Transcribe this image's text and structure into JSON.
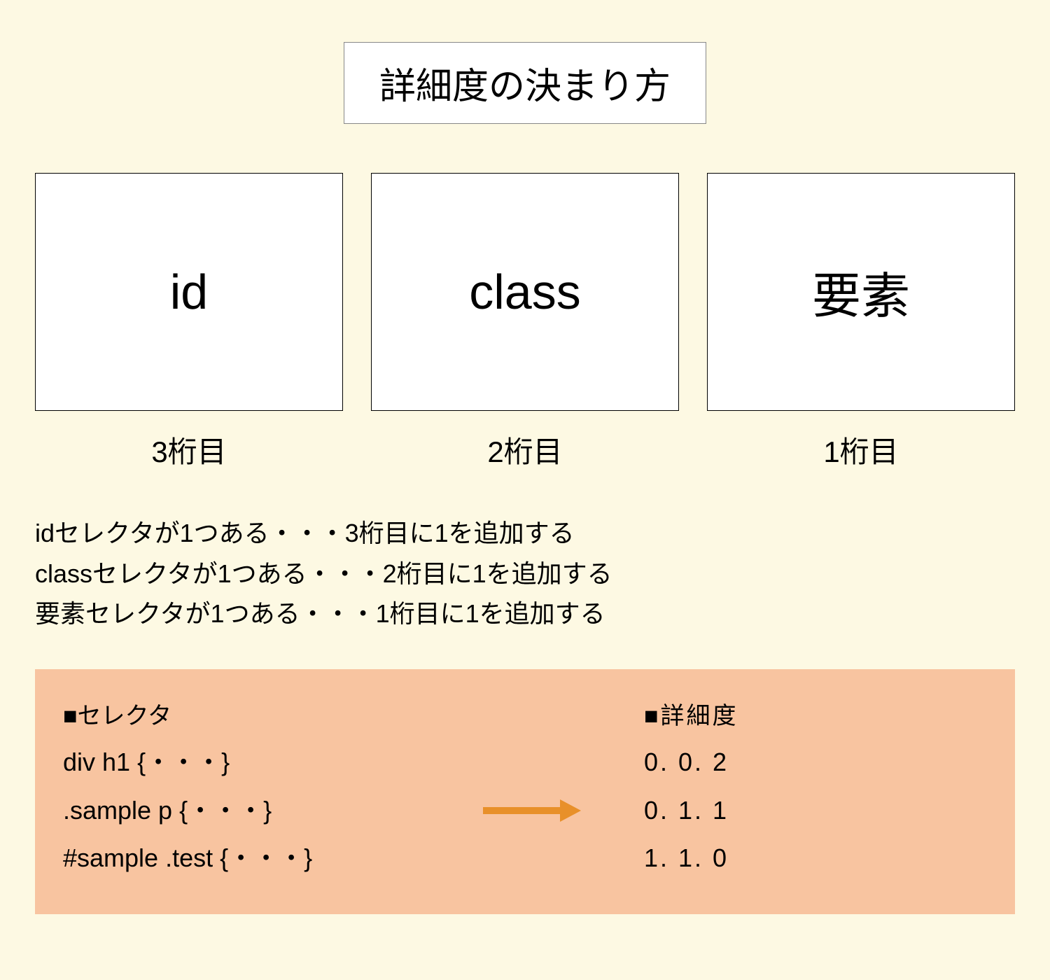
{
  "title": "詳細度の決まり方",
  "boxes": [
    {
      "label": "id",
      "digit": "3桁目"
    },
    {
      "label": "class",
      "digit": "2桁目"
    },
    {
      "label": "要素",
      "digit": "1桁目"
    }
  ],
  "rules": [
    "idセレクタが1つある・・・3桁目に1を追加する",
    "classセレクタが1つある・・・2桁目に1を追加する",
    "要素セレクタが1つある・・・1桁目に1を追加する"
  ],
  "example": {
    "selector_header": "■セレクタ",
    "spec_header": "■詳細度",
    "rows": [
      {
        "selector": "div h1 {・・・}",
        "spec": "0. 0. 2"
      },
      {
        "selector": ".sample p {・・・}",
        "spec": "0. 1. 1"
      },
      {
        "selector": "#sample .test {・・・}",
        "spec": "1. 1. 0"
      }
    ]
  }
}
